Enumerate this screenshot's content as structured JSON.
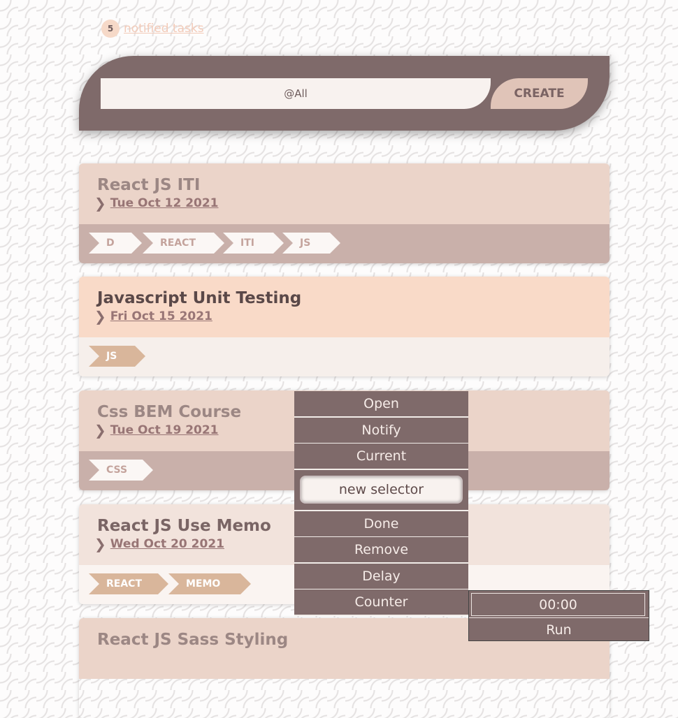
{
  "notified": {
    "count": "5",
    "label": "notified tasks"
  },
  "create_bar": {
    "input_value": "@All",
    "button_label": "CREATE"
  },
  "cards": [
    {
      "title": "React JS ITI",
      "date": "Tue Oct 12 2021",
      "tags": [
        "D",
        "REACT",
        "ITI",
        "JS"
      ]
    },
    {
      "title": "Javascript Unit Testing",
      "date": "Fri Oct 15 2021",
      "tags": [
        "JS"
      ]
    },
    {
      "title": "Css BEM Course",
      "date": "Tue Oct 19 2021",
      "tags": [
        "CSS"
      ]
    },
    {
      "title": "React JS Use Memo",
      "date": "Wed Oct 20 2021",
      "tags": [
        "REACT",
        "MEMO"
      ]
    },
    {
      "title": "React JS Sass Styling"
    }
  ],
  "context_menu": {
    "items": [
      "Open",
      "Notify",
      "Current",
      "Done",
      "Remove",
      "Delay",
      "Counter"
    ],
    "selector_value": "new selector"
  },
  "counter_popup": {
    "time": "00:00",
    "run_label": "Run"
  },
  "colors": {
    "brand_dark": "#7f6a6a",
    "accent_peach": "#f9dac8",
    "card_default": "#ebd4c9",
    "tag_bar": "#c9b0aa"
  },
  "icons": {
    "date_prefix": "chevron-right-icon"
  }
}
